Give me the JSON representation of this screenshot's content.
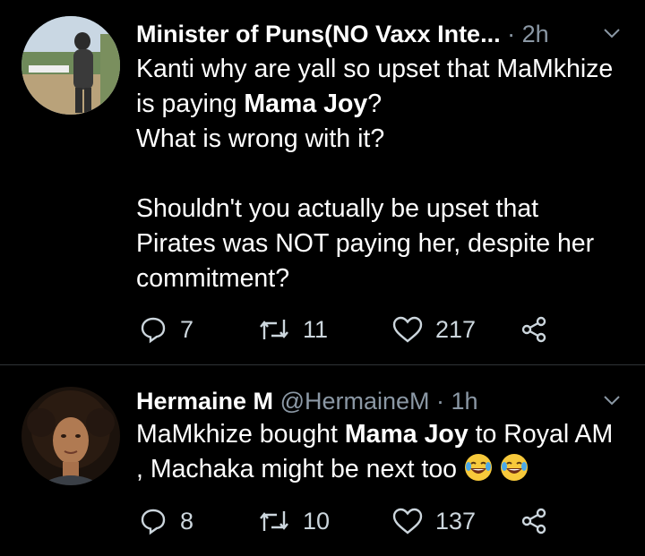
{
  "tweets": [
    {
      "display_name": "Minister of Puns(NO Vaxx Inte...",
      "time": "2h",
      "text_part1": "Kanti why are yall so upset that MaMkhize is paying ",
      "text_bold": "Mama Joy",
      "text_part2": "?\nWhat is wrong with it?\n\nShouldn't you actually be upset that Pirates was NOT paying her, despite her commitment?",
      "replies": "7",
      "retweets": "11",
      "likes": "217"
    },
    {
      "display_name": "Hermaine M",
      "handle": "@HermaineM",
      "time": "1h",
      "text_part1": "MaMkhize bought ",
      "text_bold": "Mama Joy",
      "text_part2": " to Royal AM , Machaka might be next too",
      "emojis": [
        "face-with-tears-of-joy",
        "face-with-tears-of-joy"
      ],
      "replies": "8",
      "retweets": "10",
      "likes": "137"
    }
  ],
  "colors": {
    "background": "#000000",
    "text": "#ffffff",
    "secondary": "#8b98a5",
    "divider": "#2f3336"
  }
}
